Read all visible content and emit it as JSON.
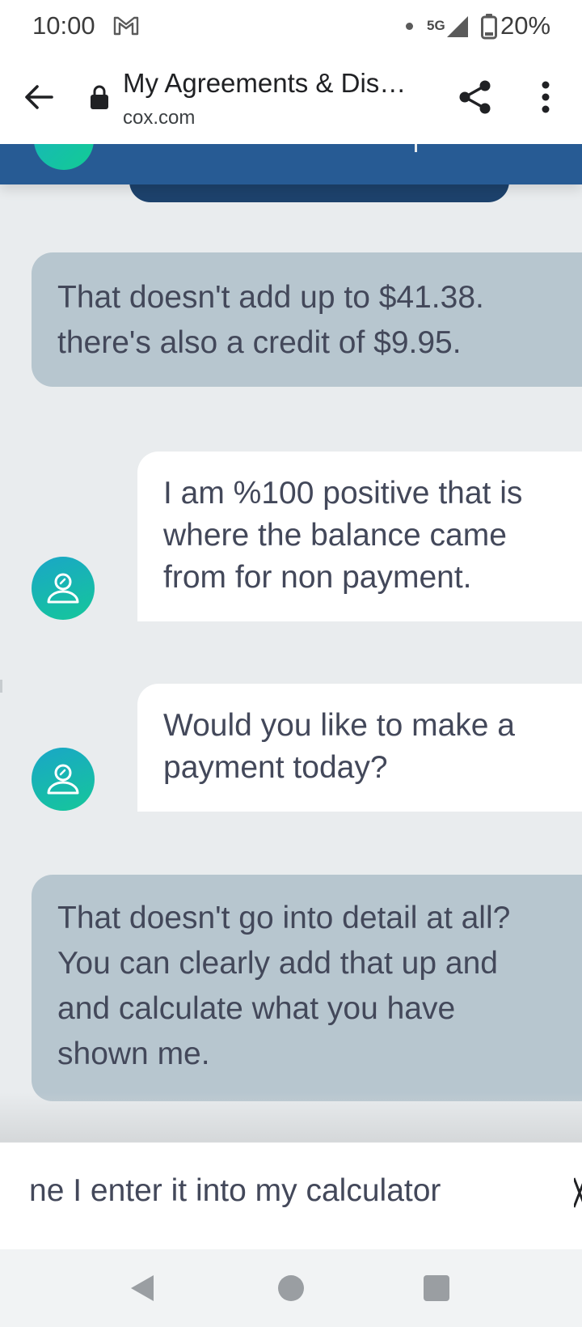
{
  "status_bar": {
    "time": "10:00",
    "network": "5G",
    "battery": "20%",
    "icons": [
      "gmail-icon",
      "dot-icon",
      "signal-icon",
      "battery-icon"
    ]
  },
  "toolbar": {
    "page_title": "My Agreements & Dis…",
    "url": "cox.com",
    "icons": [
      "back-arrow-icon",
      "lock-icon",
      "share-icon",
      "more-vert-icon"
    ]
  },
  "chat": {
    "messages": [
      {
        "sender": "user",
        "text": "That doesn't add up to $41.38.\nthere's also a credit of $9.95."
      },
      {
        "sender": "agent",
        "text": "I am %100 positive that is\nwhere the balance came\nfrom for non payment."
      },
      {
        "sender": "agent",
        "text": "Would you like to make a\npayment today?"
      },
      {
        "sender": "user",
        "text": "That doesn't go into detail at all?\nYou can clearly add that up and\nand calculate what you have\nshown me."
      }
    ]
  },
  "input": {
    "value": "ne I enter it into my calculator"
  },
  "colors": {
    "header": "#275b94",
    "user_bubble": "#b7c6cf",
    "agent_bubble": "#ffffff",
    "chat_bg": "#e9ecee",
    "avatar_gradient": [
      "#1aa6c7",
      "#15c79a"
    ]
  }
}
